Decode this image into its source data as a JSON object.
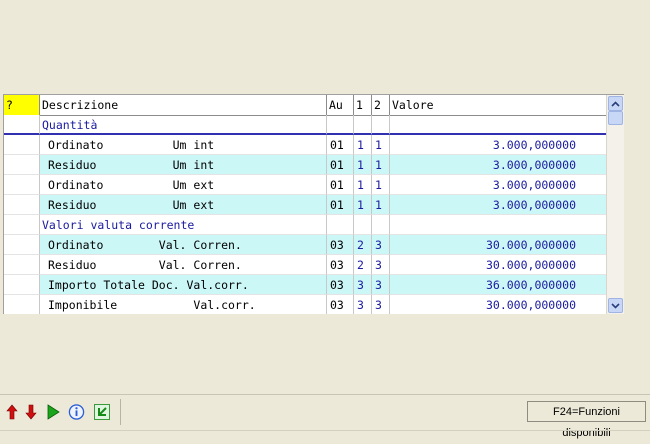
{
  "grid": {
    "headers": {
      "q": "?",
      "descrizione": "Descrizione",
      "au": "Au",
      "c1": "1",
      "c2": "2",
      "valore": "Valore"
    },
    "rows": [
      {
        "descrizione": "Quantità",
        "au": "",
        "c1": "",
        "c2": "",
        "valore": ""
      },
      {
        "descrizione": "Ordinato          Um int",
        "au": "01",
        "c1": "1",
        "c2": "1",
        "valore": "3.000,000000"
      },
      {
        "descrizione": "Residuo           Um int",
        "au": "01",
        "c1": "1",
        "c2": "1",
        "valore": "3.000,000000"
      },
      {
        "descrizione": "Ordinato          Um ext",
        "au": "01",
        "c1": "1",
        "c2": "1",
        "valore": "3.000,000000"
      },
      {
        "descrizione": "Residuo           Um ext",
        "au": "01",
        "c1": "1",
        "c2": "1",
        "valore": "3.000,000000"
      },
      {
        "descrizione": "Valori valuta corrente",
        "au": "",
        "c1": "",
        "c2": "",
        "valore": ""
      },
      {
        "descrizione": "Ordinato        Val. Corren.",
        "au": "03",
        "c1": "2",
        "c2": "3",
        "valore": "30.000,000000"
      },
      {
        "descrizione": "Residuo         Val. Corren.",
        "au": "03",
        "c1": "2",
        "c2": "3",
        "valore": "30.000,000000"
      },
      {
        "descrizione": "Importo Totale Doc. Val.corr.",
        "au": "03",
        "c1": "3",
        "c2": "3",
        "valore": "36.000,000000"
      },
      {
        "descrizione": "Imponibile           Val.corr.",
        "au": "03",
        "c1": "3",
        "c2": "3",
        "valore": "30.000,000000"
      }
    ]
  },
  "toolbar": {
    "icons": [
      "arrow-up-icon",
      "arrow-down-icon",
      "play-icon",
      "info-icon",
      "back-icon"
    ]
  },
  "status": {
    "functions_label": "F24=Funzioni disponibili"
  },
  "colors": {
    "window_bg": "#ece9d8",
    "alt_row": "#ccf7f7",
    "value_text": "#1a1aa0",
    "header_marker": "#ffff00"
  }
}
